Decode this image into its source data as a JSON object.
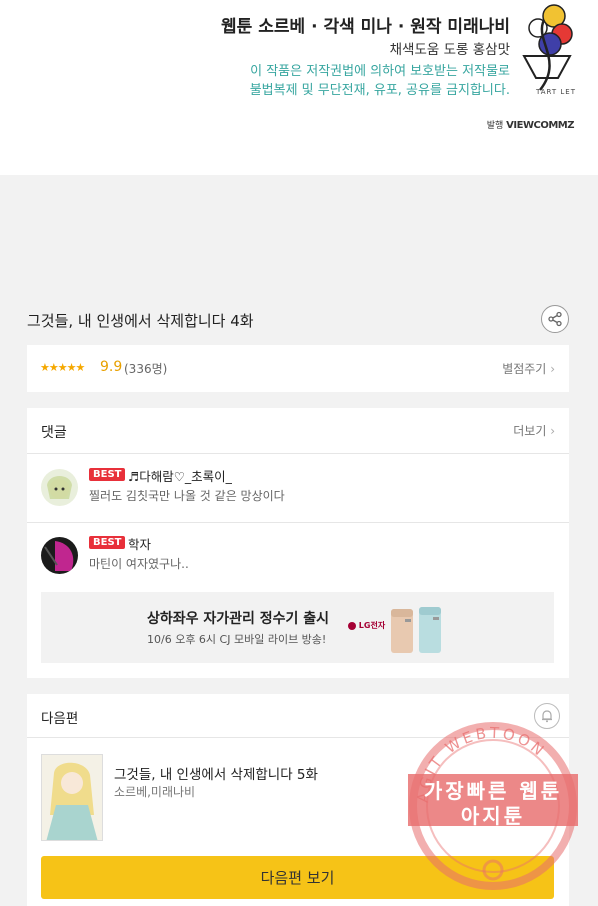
{
  "credits": {
    "line1": "웹툰 소르베 · 각색 미나 · 원작 미래나비",
    "line2": "채색도움 도롱 홍삼맛",
    "copyright_line1": "이 작품은 저작권법에 의하여 보호받는 저작물로",
    "copyright_line2": "불법복제 및 무단전재, 유포, 공유를 금지합니다.",
    "publisher_label": "발행",
    "publisher_name": "VIEWCOMMZ",
    "logo_text": "TART LET"
  },
  "episode": {
    "title": "그것들, 내 인생에서 삭제합니다 4화",
    "share_icon": "share-icon"
  },
  "rating": {
    "stars": "★★★★★",
    "score": "9.9",
    "count": "(336명)",
    "rate_link": "별점주기"
  },
  "comments": {
    "heading": "댓글",
    "more_link": "더보기",
    "items": [
      {
        "badge": "BEST",
        "nickname": "♬다해람♡_초록이_",
        "text": "찔러도 김칫국만 나올 것 같은 망상이다"
      },
      {
        "badge": "BEST",
        "nickname": "학자",
        "text": "마틴이 여자였구나.."
      }
    ]
  },
  "ad": {
    "title": "상하좌우 자가관리 정수기 출시",
    "subtitle": "10/6 오후 6시 CJ 모바일 라이브 방송!",
    "brand": "LG전자"
  },
  "next_episode": {
    "heading": "다음편",
    "title": "그것들, 내 인생에서 삭제합니다 5화",
    "authors": "소르베,미래나비",
    "button_label": "다음편 보기"
  },
  "watermark": {
    "ring_text": "AGIT WEBTOON",
    "line1": "가장빠른 웹툰",
    "line2": "아지툰"
  },
  "colors": {
    "accent_yellow": "#f6c317",
    "best_red": "#e8303a",
    "copyright_teal": "#37a6a0",
    "star_orange": "#f5a800"
  }
}
